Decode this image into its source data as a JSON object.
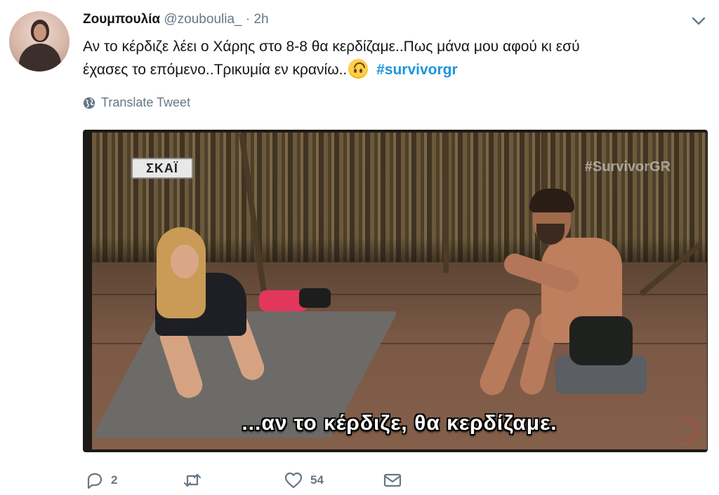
{
  "tweet": {
    "author_name": "Ζουμπουλία",
    "handle": "@zouboulia_",
    "separator": "·",
    "time": "2h",
    "text_line1": "Αν το κέρδιζε λέει ο Χάρης στο 8-8 θα κερδίζαμε..Πως μάνα μου αφού κι εσύ",
    "text_line2": "έχασες το επόμενο..Τρικυμία εν κρανίω..",
    "hashtag": "#survivorgr",
    "translate_label": "Translate Tweet"
  },
  "media": {
    "channel_logo": "ΣΚΑΪ",
    "watermark": "#SurvivorGR",
    "subtitle": "...αν το κέρδιζε, θα κερδίζαμε."
  },
  "actions": {
    "reply_count": "2",
    "retweet_count": "",
    "like_count": "54"
  },
  "icons": {
    "reply": "reply-icon",
    "retweet": "retweet-icon",
    "like": "heart-icon",
    "dm": "envelope-icon",
    "translate": "globe-icon",
    "menu": "chevron-down-icon",
    "emoji": "upside-down-face-emoji"
  },
  "colors": {
    "hashtag": "#1b95e0",
    "secondary_text": "#657786",
    "primary_text": "#14171a"
  }
}
